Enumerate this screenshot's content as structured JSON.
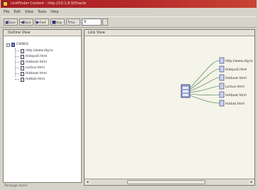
{
  "window": {
    "title": "LinkFinder Content - http://10.1.8.9/Oracle"
  },
  "menu": [
    "File",
    "Edit",
    "View",
    "Tools",
    "Help"
  ],
  "toolbar": {
    "buttons": [
      {
        "icon": "save-icon",
        "glyph": "▣",
        "label": "Save"
      },
      {
        "icon": "back-icon",
        "glyph": "◀",
        "label": "Back"
      },
      {
        "icon": "forward-icon",
        "glyph": "▶",
        "label": "Fwd"
      },
      {
        "icon": "stop-icon",
        "glyph": "■",
        "label": "Stop"
      },
      {
        "icon": "refresh-icon",
        "glyph": "↻",
        "label": "Go"
      }
    ],
    "input_value": "9"
  },
  "outline": {
    "header": "Outline View",
    "root_label": "CWNUS",
    "children": [
      "http://www.dig.tx",
      "Hidepx0.html",
      "Hotboat.html",
      "Lorbus.html",
      "Hotboat.html",
      "Hotbat.html"
    ]
  },
  "linkview": {
    "header": "Link View",
    "nodes": [
      "http://www.dig.tx",
      "Hidepx0.html",
      "Hotboat.html",
      "Lorbus.html",
      "Hotboat.html",
      "Hotbat.html"
    ]
  },
  "status": {
    "text": "Package docs?"
  },
  "colors": {
    "titlebar": "#a51b22",
    "canvas": "#f4f4e8",
    "link_line": "#2e6b45"
  }
}
